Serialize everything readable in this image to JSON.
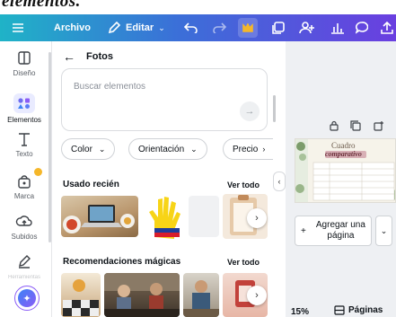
{
  "caption": {
    "text": "elementos."
  },
  "toolbar": {
    "file_label": "Archivo",
    "edit_label": "Editar"
  },
  "rail": {
    "items": [
      {
        "label": "Diseño",
        "icon": "layout-icon"
      },
      {
        "label": "Elementos",
        "icon": "shapes-icon"
      },
      {
        "label": "Texto",
        "icon": "text-icon"
      },
      {
        "label": "Marca",
        "icon": "brand-icon"
      },
      {
        "label": "Subidos",
        "icon": "upload-icon"
      },
      {
        "label": "Herramientas",
        "icon": "pen-icon"
      }
    ]
  },
  "panel": {
    "title": "Fotos",
    "search_placeholder": "Buscar elementos",
    "filters": [
      "Color",
      "Orientación",
      "Precio"
    ],
    "recent_title": "Usado recién",
    "recent_see_all": "Ver todo",
    "magic_title": "Recomendaciones mágicas",
    "magic_see_all": "Ver todo"
  },
  "canvas": {
    "add_page_label": "Agregar una página",
    "zoom": "15%",
    "pages_label": "Páginas",
    "page_thumbnail": {
      "title_line1": "Cuadro",
      "title_line2": "comparativo"
    }
  },
  "colors": {
    "toolbar_start": "#1fb3c7",
    "toolbar_end": "#6a3fe0",
    "accent": "#8b5cf6"
  }
}
